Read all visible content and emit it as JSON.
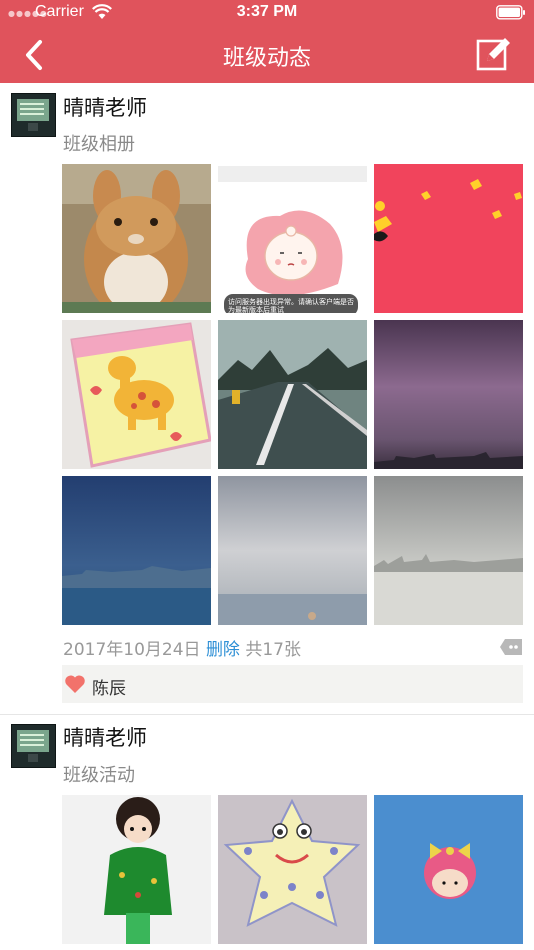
{
  "status_bar": {
    "carrier": "Carrier",
    "time": "3:37 PM"
  },
  "nav": {
    "title": "班级动态",
    "back_icon": "chevron-left-icon",
    "edit_icon": "compose-icon",
    "color": "#e0535c"
  },
  "posts": [
    {
      "author": "晴晴老师",
      "album": "班级相册",
      "date": "2017年10月24日",
      "delete_label": "删除",
      "count_label": "共17张",
      "photos": [
        {
          "subject": "rabbit"
        },
        {
          "subject": "error-placeholder",
          "caption": "访问服务器出现异常。请确认客户端是否为最新版本后重试"
        },
        {
          "subject": "red-pattern"
        },
        {
          "subject": "giraffe-craft"
        },
        {
          "subject": "road"
        },
        {
          "subject": "purple-sky"
        },
        {
          "subject": "blue-city"
        },
        {
          "subject": "grey-sea"
        },
        {
          "subject": "foggy-city"
        }
      ],
      "liked_by": "陈辰",
      "like_icon": "heart-icon",
      "comment_icon": "comment-icon"
    },
    {
      "author": "晴晴老师",
      "album": "班级活动",
      "photos": [
        {
          "subject": "clay-doll"
        },
        {
          "subject": "star-cookie"
        },
        {
          "subject": "pink-doll"
        }
      ]
    }
  ]
}
